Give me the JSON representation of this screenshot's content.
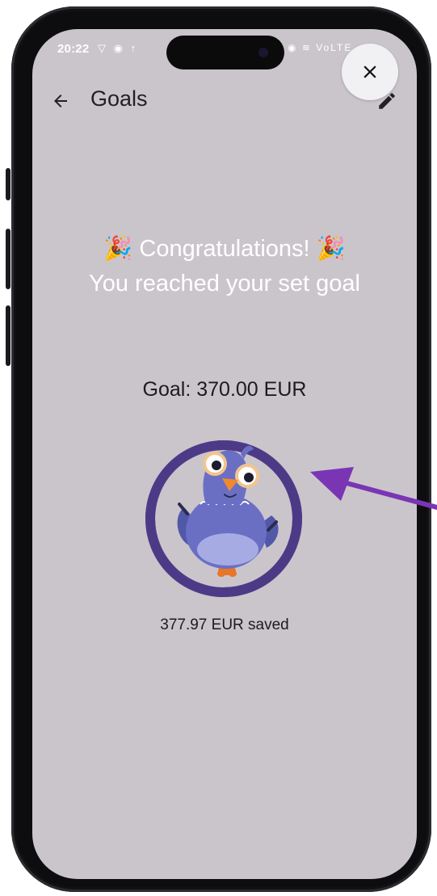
{
  "status_bar": {
    "time": "20:22",
    "left_icons": "▽ ◉ ↑",
    "right_icons": "◉ ≋ VoLTE .ıl"
  },
  "app_bar": {
    "title": "Goals",
    "back_icon": "arrow-left-icon",
    "edit_icon": "pencil-icon"
  },
  "overlay": {
    "close_icon": "close-icon"
  },
  "celebration": {
    "line1": "🎉 Congratulations! 🎉",
    "line2": "You reached your set goal"
  },
  "goal": {
    "label": "Goal: 370.00 EUR",
    "saved": "377.97 EUR saved",
    "progress_fraction": 1.0
  },
  "colors": {
    "screen_bg": "#cac5cb",
    "ring": "#4d3a87",
    "bird": "#6b6fc4",
    "annotation_arrow": "#7a35b5"
  }
}
